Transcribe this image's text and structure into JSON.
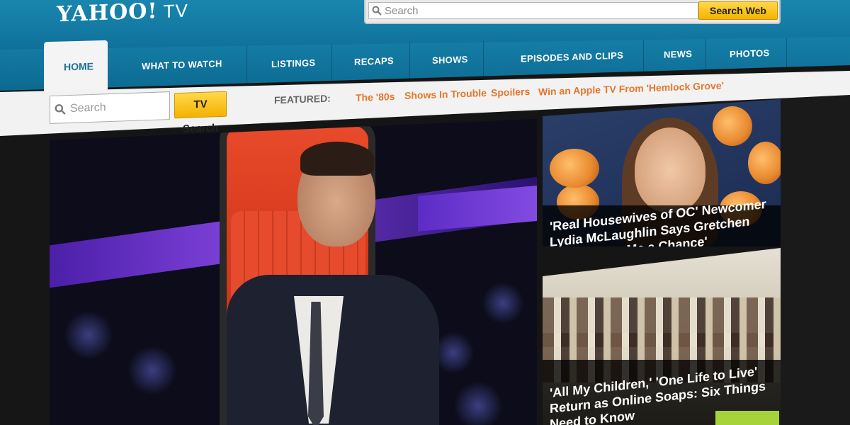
{
  "header": {
    "logo_main": "YAHOO!",
    "logo_sub": "TV",
    "web_search_placeholder": "Search",
    "web_search_button": "Search Web"
  },
  "nav": {
    "items": [
      {
        "label": "HOME"
      },
      {
        "label": "WHAT TO WATCH"
      },
      {
        "label": "LISTINGS"
      },
      {
        "label": "RECAPS"
      },
      {
        "label": "SHOWS"
      },
      {
        "label": "EPISODES AND CLIPS"
      },
      {
        "label": "NEWS"
      },
      {
        "label": "PHOTOS"
      }
    ]
  },
  "subbar": {
    "tv_search_placeholder": "Search",
    "tv_search_button": "TV Search",
    "featured_label": "FEATURED:",
    "featured_links": [
      {
        "label": "The '80s"
      },
      {
        "label": "Shows In Trouble"
      },
      {
        "label": "Spoilers"
      },
      {
        "label": "Win an Apple TV From 'Hemlock Grove'"
      }
    ]
  },
  "stories": [
    {
      "lines": [
        "'Real Housewives of OC' Newcomer",
        "Lydia McLaughlin Says Gretchen",
        "'Never Gave Me a Chance'"
      ]
    },
    {
      "lines": [
        "'All My Children,' 'One Life to Live'",
        "Return as Online Soaps: Six Things",
        "Need to Know"
      ]
    }
  ],
  "colors": {
    "nav_blue": "#137aa3",
    "accent_yellow": "#f4b300",
    "featured_orange": "#e8752a"
  }
}
